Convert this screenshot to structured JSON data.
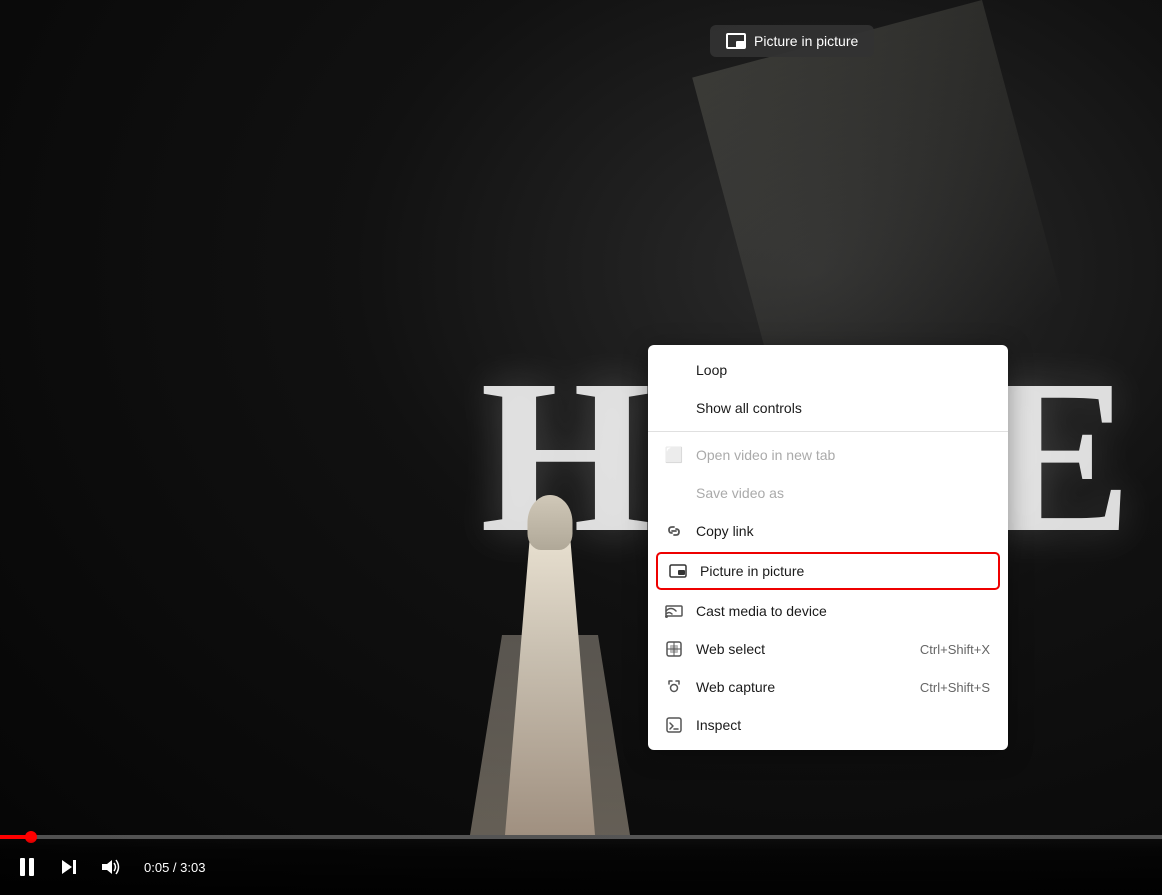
{
  "video": {
    "pip_badge": "Picture in picture",
    "current_time": "0:05",
    "total_time": "3:03",
    "time_display": "0:05 / 3:03",
    "progress_percent": 2.7
  },
  "controls": {
    "pause_label": "Pause",
    "skip_label": "Skip",
    "volume_label": "Volume"
  },
  "context_menu": {
    "items": [
      {
        "id": "loop",
        "label": "Loop",
        "icon": "",
        "shortcut": "",
        "disabled": false,
        "divider_after": false
      },
      {
        "id": "show-controls",
        "label": "Show all controls",
        "icon": "",
        "shortcut": "",
        "disabled": false,
        "divider_after": true
      },
      {
        "id": "open-tab",
        "label": "Open video in new tab",
        "icon": "tab",
        "shortcut": "",
        "disabled": true,
        "divider_after": false
      },
      {
        "id": "save-video",
        "label": "Save video as",
        "icon": "",
        "shortcut": "",
        "disabled": true,
        "divider_after": false
      },
      {
        "id": "copy-link",
        "label": "Copy link",
        "icon": "link",
        "shortcut": "",
        "disabled": false,
        "divider_after": false
      },
      {
        "id": "pip",
        "label": "Picture in picture",
        "icon": "pip",
        "shortcut": "",
        "disabled": false,
        "highlighted": true,
        "divider_after": false
      },
      {
        "id": "cast",
        "label": "Cast media to device",
        "icon": "cast",
        "shortcut": "",
        "disabled": false,
        "divider_after": false
      },
      {
        "id": "web-select",
        "label": "Web select",
        "icon": "web-select",
        "shortcut": "Ctrl+Shift+X",
        "disabled": false,
        "divider_after": false
      },
      {
        "id": "web-capture",
        "label": "Web capture",
        "icon": "capture",
        "shortcut": "Ctrl+Shift+S",
        "disabled": false,
        "divider_after": false
      },
      {
        "id": "inspect",
        "label": "Inspect",
        "icon": "inspect",
        "shortcut": "",
        "disabled": false,
        "divider_after": false
      }
    ]
  }
}
